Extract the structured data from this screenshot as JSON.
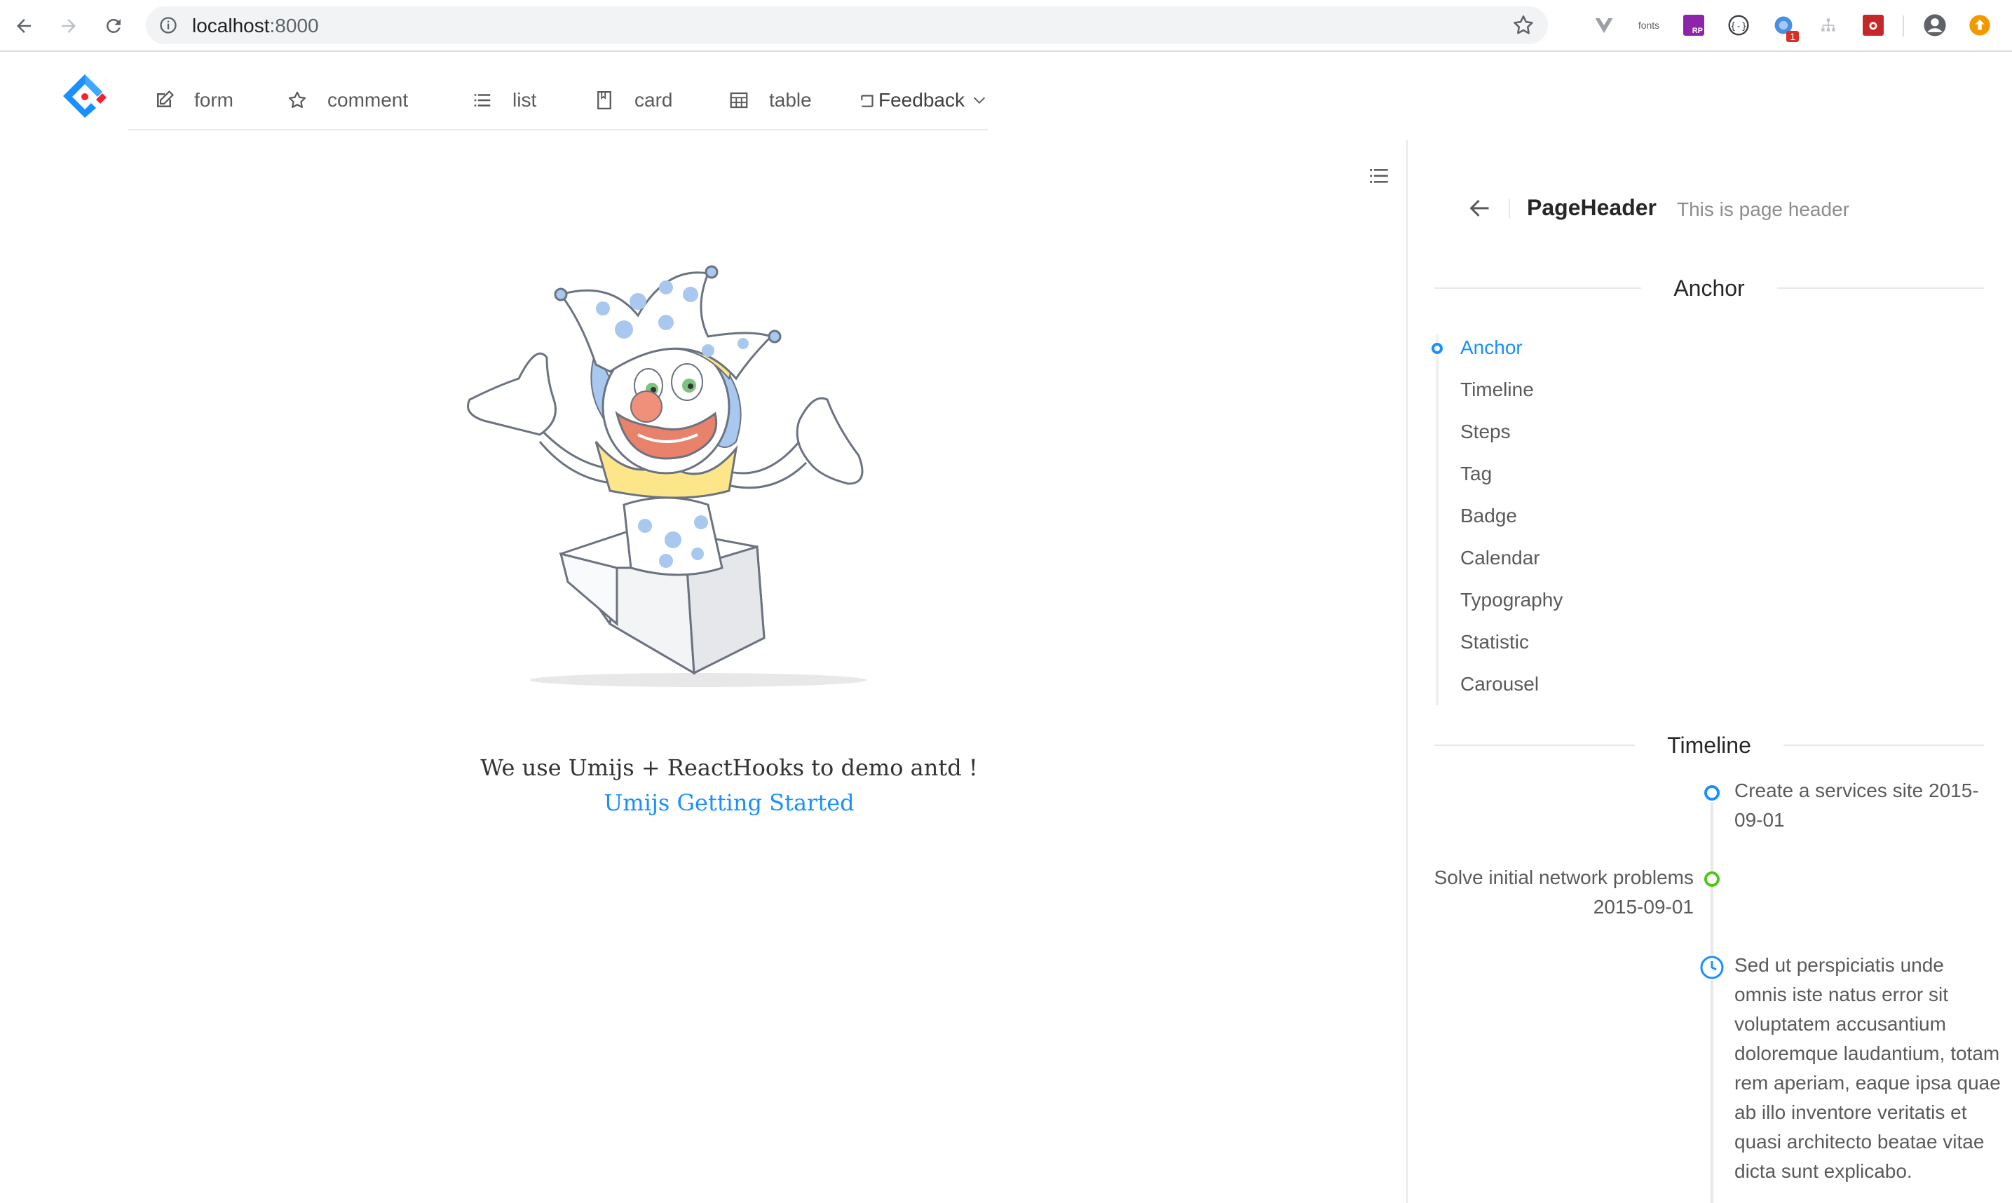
{
  "browser": {
    "url_host": "localhost",
    "url_port": ":8000",
    "extensions": [
      "vue-devtools-icon",
      "fonts-icon",
      "rp-icon",
      "code-icon",
      "translate-icon",
      "sitemap-icon",
      "bug-icon",
      "profile-icon",
      "update-icon"
    ],
    "fonts_label": "fonts",
    "rp_label": "RP",
    "translate_badge": "1"
  },
  "menu": {
    "items": [
      {
        "label": "form",
        "icon": "edit-icon"
      },
      {
        "label": "comment",
        "icon": "star-icon"
      },
      {
        "label": "list",
        "icon": "bars-icon"
      },
      {
        "label": "card",
        "icon": "book-icon"
      },
      {
        "label": "table",
        "icon": "table-icon"
      }
    ],
    "feedback": "Feedback"
  },
  "main": {
    "intro_text": "We use Umijs + ReactHooks to demo antd !",
    "link_text": "Umijs Getting Started"
  },
  "page_header": {
    "title": "PageHeader",
    "subtitle": "This is page header"
  },
  "anchor_section": {
    "heading": "Anchor",
    "links": [
      "Anchor",
      "Timeline",
      "Steps",
      "Tag",
      "Badge",
      "Calendar",
      "Typography",
      "Statistic",
      "Carousel"
    ],
    "active_index": 0
  },
  "timeline_section": {
    "heading": "Timeline",
    "items": [
      {
        "text": "Create a services site 2015-09-01",
        "color": "#1890ff",
        "side": "right"
      },
      {
        "text": "Solve initial network problems 2015-09-01",
        "color": "#52c41a",
        "side": "left"
      },
      {
        "text": "Sed ut perspiciatis unde omnis iste natus error sit voluptatem accusantium doloremque laudantium, totam rem aperiam, eaque ipsa quae ab illo inventore veritatis et quasi architecto beatae vitae dicta sunt explicabo.",
        "color": "#1890ff",
        "side": "right",
        "icon": "clock-icon"
      }
    ]
  },
  "colors": {
    "primary": "#1890ff",
    "success": "#52c41a",
    "text": "rgba(0,0,0,0.65)"
  }
}
